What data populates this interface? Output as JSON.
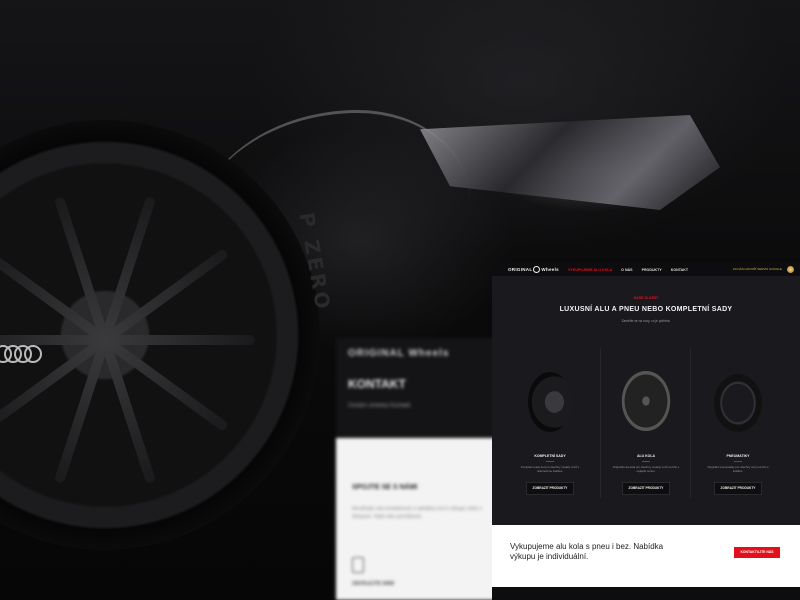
{
  "site": {
    "nav": {
      "brand_left": "ORIGINAL",
      "brand_right": "Wheels",
      "items": [
        {
          "label": "VYKUPUJEME ALU KOLA",
          "active": true
        },
        {
          "label": "O NÁS",
          "active": false
        },
        {
          "label": "PRODUKTY",
          "active": false
        },
        {
          "label": "KONTAKT",
          "active": false
        }
      ],
      "right_text": "ZA NÁS HOVOŘÍ SERVIS GOOGLE"
    },
    "hero": {
      "eyebrow": "NAŠE SLUŽBY",
      "title": "LUXUSNÍ ALU A PNEU NEBO KOMPLETNÍ SADY",
      "subline": "Zaměřte se na vozy, co je potřeba."
    },
    "products": [
      {
        "name": "KOMPLETNÍ SADY",
        "desc": "Kompletní sady kol pro všechny modely vozů s nekonečnou kvalitou.",
        "button": "ZOBRAZIT PRODUKTY",
        "icon": "complete-set-icon"
      },
      {
        "name": "ALU KOLA",
        "desc": "Originální alu kola pro všechny modely vozů na trhu s nejlepší cenou.",
        "button": "ZOBRAZIT PRODUKTY",
        "icon": "alloy-wheel-icon"
      },
      {
        "name": "PNEUMATIKY",
        "desc": "Originální pneumatiky pro všechny vozy na trhu s kvalitou.",
        "button": "ZOBRAZIT PRODUKTY",
        "icon": "tyre-icon"
      }
    ],
    "footer": {
      "text": "Vykupujeme alu kola s pneu i bez. Nabídka výkupu je individuální.",
      "button": "KONTAKTUJTE NÁS"
    },
    "accent": "#e30f1b"
  },
  "contact_page": {
    "logo": "ORIGINAL Wheels",
    "title": "KONTAKT",
    "crumbs": "Úvodní stránka      Kontakt",
    "heading": "SPOJTE SE S NÁMI",
    "paragraph": "Neváhejte nás kontaktovat s nabídkou kol k výkupu nebo s dotazem. Rádi vám pomůžeme.",
    "link": "ZAVOLEJTE NÁM"
  },
  "background": {
    "tire_text": "P ZERO"
  }
}
